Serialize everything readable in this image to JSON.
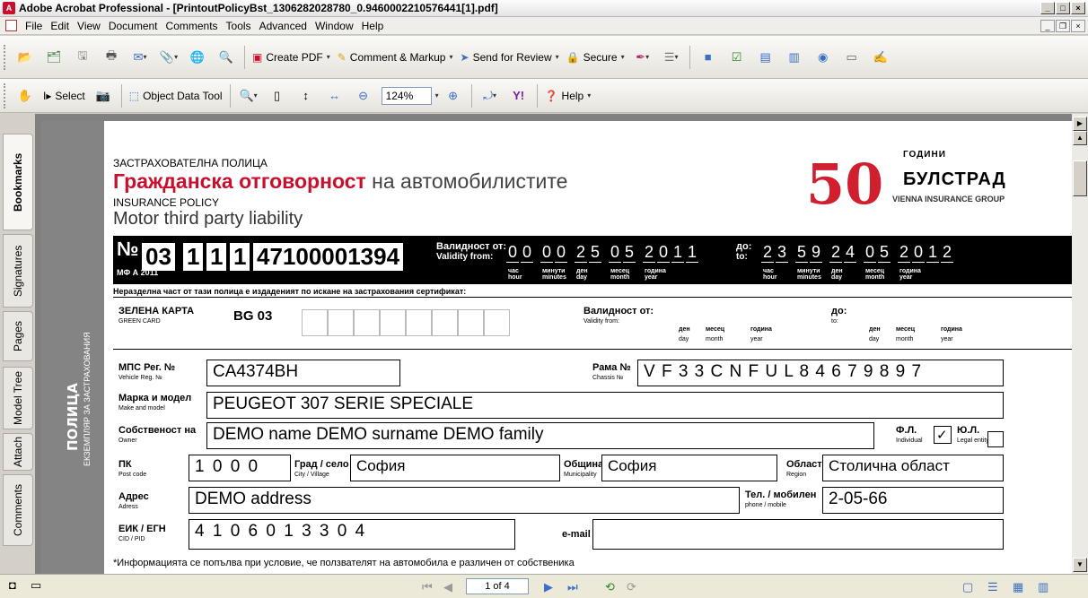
{
  "window": {
    "title": "Adobe Acrobat Professional - [PrintoutPolicyBst_1306282028780_0.9460002210576441[1].pdf]"
  },
  "menu": [
    "File",
    "Edit",
    "View",
    "Document",
    "Comments",
    "Tools",
    "Advanced",
    "Window",
    "Help"
  ],
  "toolbar1": {
    "create_pdf": "Create PDF",
    "comment_markup": "Comment & Markup",
    "send_review": "Send for Review",
    "secure": "Secure"
  },
  "toolbar2": {
    "select": "Select",
    "object_data_tool": "Object Data Tool",
    "zoom": "124%",
    "help": "Help"
  },
  "side_tabs": [
    "Bookmarks",
    "Signatures",
    "Pages",
    "Model Tree",
    "Attach",
    "Comments"
  ],
  "doc": {
    "side_title": "ПОЛИЦА",
    "side_sub": "ЕКЗЕМПЛЯР ЗА ЗАСТРАХОВАНИЯ",
    "h1": "ЗАСТРАХОВАТЕЛНА ПОЛИЦА",
    "h2a": "Гражданска отговорност",
    "h2b": " на автомобилистите",
    "h3": "INSURANCE POLICY",
    "h4": "Motor third party liability",
    "logo": {
      "years": "ГОДИНИ",
      "number": "50",
      "brand": "БУЛСТРАД",
      "group": "VIENNA INSURANCE GROUP"
    },
    "policy": {
      "no_label": "№",
      "mfa": "МФ А 2011",
      "series": "03",
      "d1": "1",
      "d2": "1",
      "d3": "1",
      "number": "47100001394",
      "valid_from_bg": "Валидност от:",
      "valid_from_en": "Validity from:",
      "to_bg": "до:",
      "to_en": "to:",
      "from_digits": [
        "0",
        "0",
        "0",
        "0",
        "2",
        "5",
        "0",
        "5",
        "2",
        "0",
        "1",
        "1"
      ],
      "to_digits": [
        "2",
        "3",
        "5",
        "9",
        "2",
        "4",
        "0",
        "5",
        "2",
        "0",
        "1",
        "2"
      ],
      "units": [
        "час",
        "минути",
        "ден",
        "месец",
        "година"
      ],
      "units_en": [
        "hour",
        "minutes",
        "day",
        "month",
        "year"
      ],
      "units_to_en": [
        "hour",
        "minutes",
        "day",
        "month",
        "year"
      ]
    },
    "note1": "Неразделна част от тази полица е издаденият по искане на застрахования сертификат:",
    "green_card": {
      "label": "ЗЕЛЕНА КАРТА",
      "label_en": "GREEN CARD",
      "value": "BG 03",
      "valid_from": "Валидност от:",
      "valid_from_en": "Validity from:",
      "to": "до:",
      "to_en": "to:",
      "day": "ден",
      "day_en": "day",
      "month": "месец",
      "month_en": "month",
      "year": "година",
      "year_en": "year"
    },
    "fields": {
      "reg_label": "МПС Рег. №",
      "reg_label_en": "Vehicle Reg. №",
      "reg": "CA4374BH",
      "frame_label": "Рама №",
      "frame_label_en": "Chassis №",
      "frame": "V F 3 3 C N F U L 8 4 6 7 9 8 9 7",
      "make_label": "Марка и модел",
      "make_label_en": "Make and model",
      "make": "PEUGEOT 307 SERIE SPECIALE",
      "owner_label": "Собственост на",
      "owner_label_en": "Owner",
      "owner": "DEMO name DEMO surname DEMO family",
      "fl_label": "Ф.Л.",
      "fl_label_en": "Individual",
      "ul_label": "Ю.Л.",
      "ul_label_en": "Legal entity",
      "pk_label": "ПК",
      "pk_label_en": "Post code",
      "pk": "1 0 0 0",
      "city_label": "Град / село",
      "city_label_en": "City / Village",
      "city": "София",
      "mun_label": "Община",
      "mun_label_en": "Municipality",
      "mun": "София",
      "region_label": "Област",
      "region_label_en": "Region",
      "region": "Столична област",
      "addr_label": "Адрес",
      "addr_label_en": "Adress",
      "addr": "DEMO address",
      "phone_label": "Тел. / мобилен",
      "phone_label_en": "phone / mobile",
      "phone": "2-05-66",
      "egn_label": "ЕИК / ЕГН",
      "egn_label_en": "CID / PID",
      "egn": "4 1 0 6 0 1 3 3 0 4",
      "email_label": "e-mail",
      "email": ""
    },
    "note2": "*Информацията се попълва при условие, че ползвателят на автомобила е различен от собственика"
  },
  "status": {
    "page": "1 of 4"
  }
}
